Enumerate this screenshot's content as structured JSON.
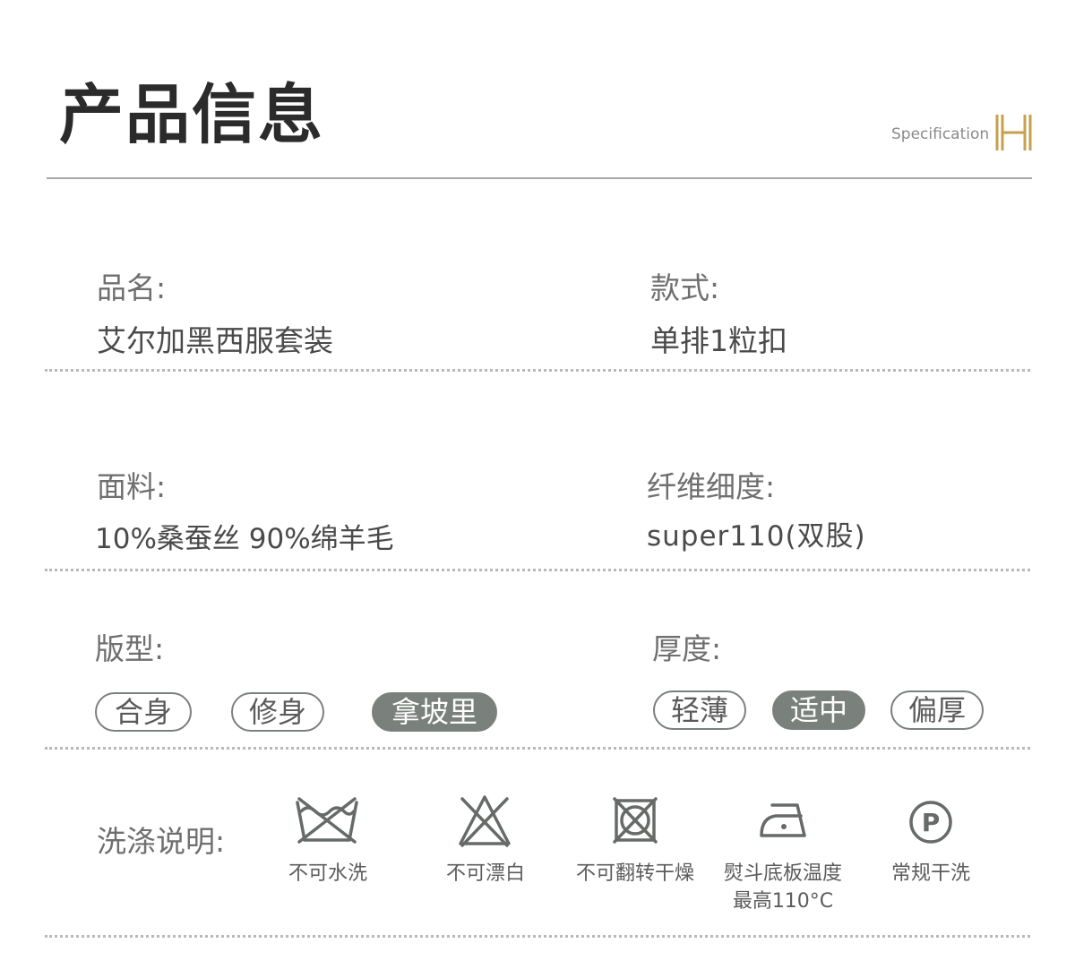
{
  "header": {
    "title": "产品信息",
    "subtitle": "Specification",
    "logo_letter": "H",
    "accent_color": "#c5a04f"
  },
  "info": {
    "name_label": "品名:",
    "name_value": "艾尔加黑西服套装",
    "style_label": "款式:",
    "style_value": "单排1粒扣",
    "fabric_label": "面料:",
    "fabric_value": "10%桑蚕丝 90%绵羊毛",
    "fiber_label": "纤维细度:",
    "fiber_value": "super110(双股)"
  },
  "fit": {
    "label": "版型:",
    "options": [
      "合身",
      "修身",
      "拿坡里"
    ],
    "selected": "拿坡里"
  },
  "thickness": {
    "label": "厚度:",
    "options": [
      "轻薄",
      "适中",
      "偏厚"
    ],
    "selected": "适中"
  },
  "care": {
    "label": "洗涤说明:",
    "items": [
      {
        "icon": "no-wash-icon",
        "text": "不可水洗"
      },
      {
        "icon": "no-bleach-icon",
        "text": "不可漂白"
      },
      {
        "icon": "no-tumble-dry-icon",
        "text": "不可翻转干燥"
      },
      {
        "icon": "iron-medium-icon",
        "text": "熨斗底板温度",
        "text2": "最高110°C"
      },
      {
        "icon": "dry-clean-p-icon",
        "text": "常规干洗",
        "symbol": "P"
      }
    ]
  },
  "colors": {
    "chip_active": "#7a807c",
    "icon": "#666b68"
  }
}
